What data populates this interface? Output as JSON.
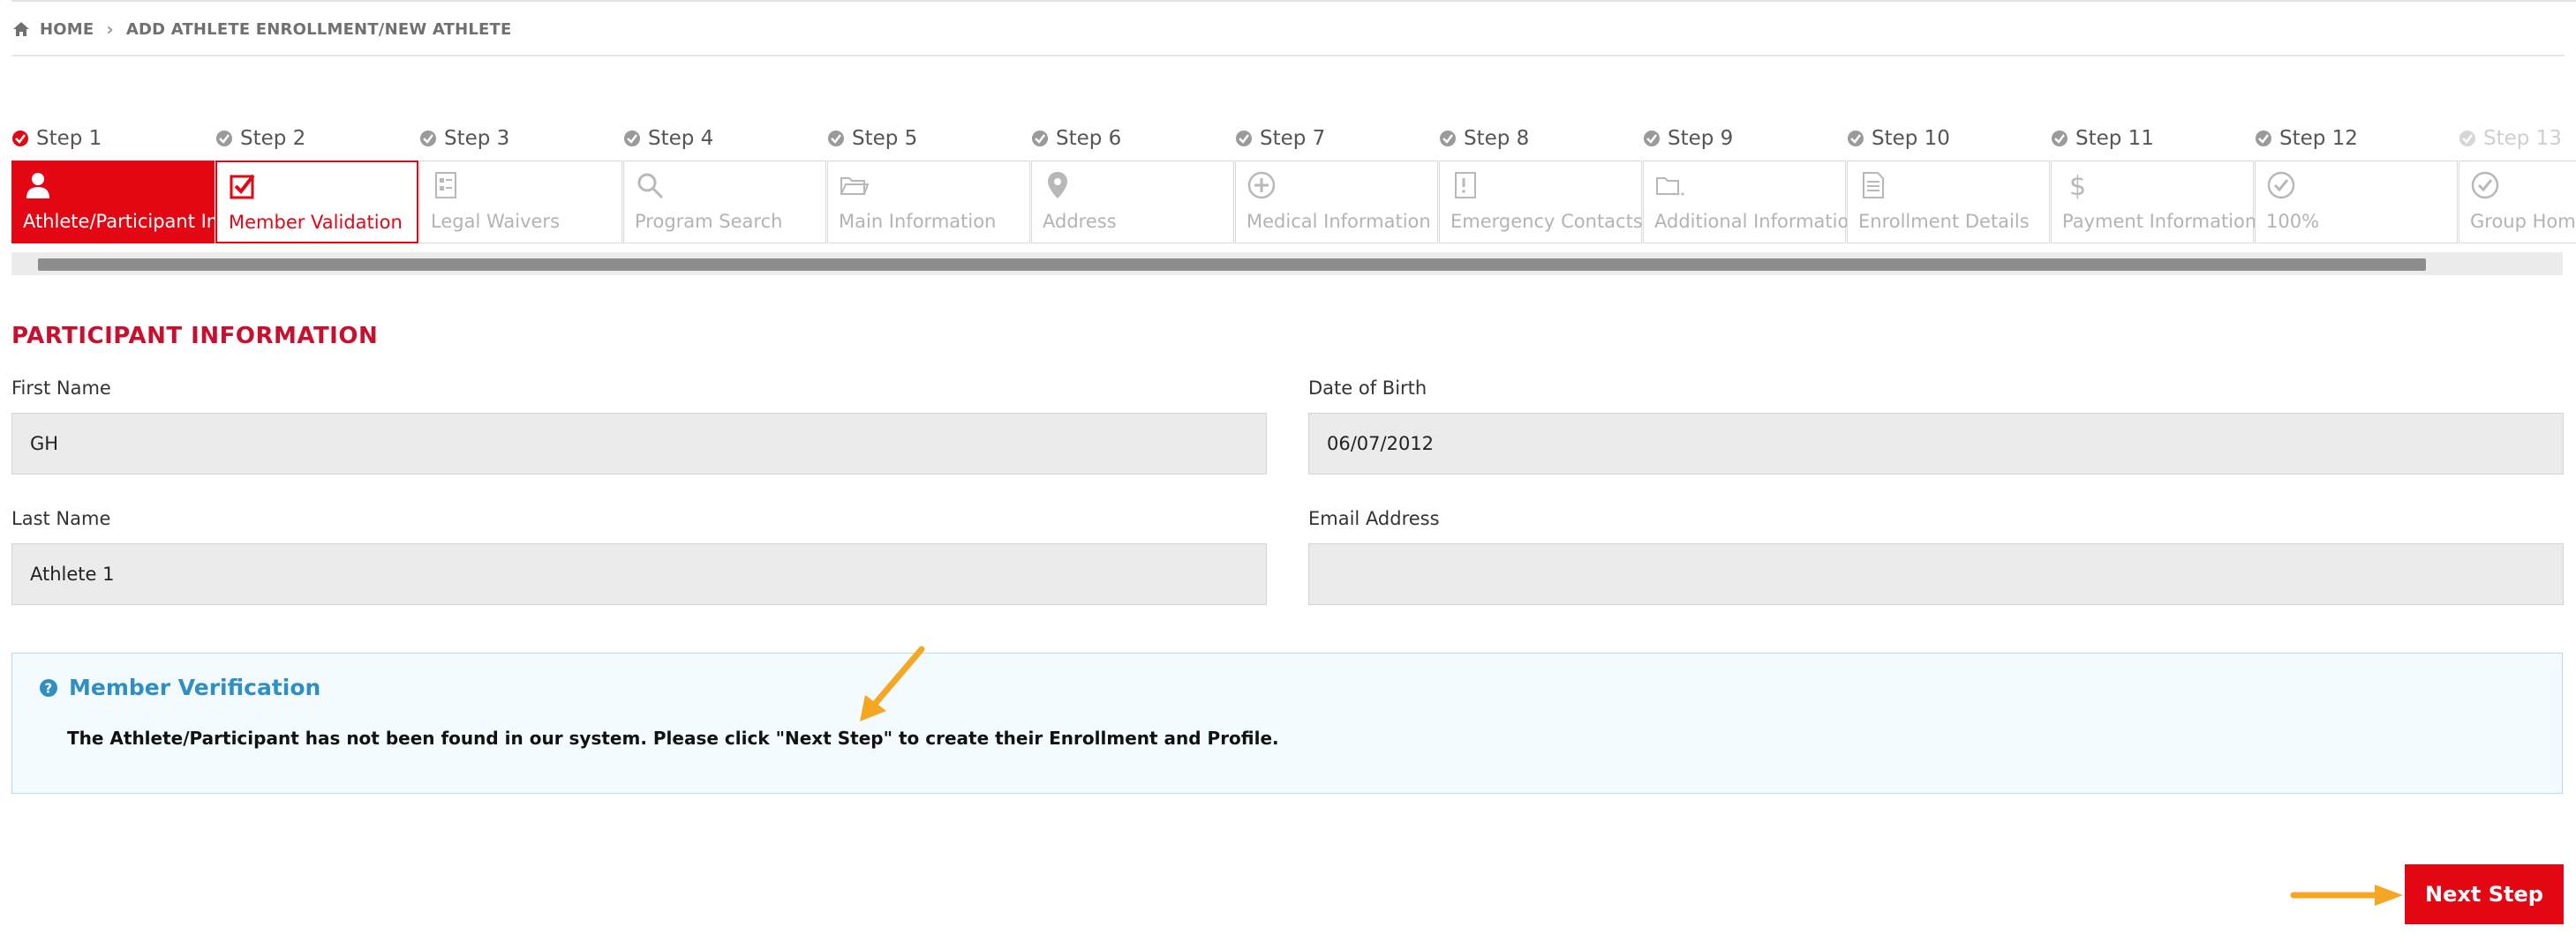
{
  "breadcrumb": {
    "home": "HOME",
    "current": "ADD ATHLETE ENROLLMENT/NEW ATHLETE"
  },
  "steps": [
    {
      "step": "Step 1",
      "label": "Athlete/Participant Info",
      "icon": "person-icon",
      "state": "active"
    },
    {
      "step": "Step 2",
      "label": "Member Validation",
      "icon": "checkbox-icon",
      "state": "current"
    },
    {
      "step": "Step 3",
      "label": "Legal Waivers",
      "icon": "form-icon",
      "state": "pending"
    },
    {
      "step": "Step 4",
      "label": "Program Search",
      "icon": "search-icon",
      "state": "pending"
    },
    {
      "step": "Step 5",
      "label": "Main Information",
      "icon": "folder-icon",
      "state": "pending"
    },
    {
      "step": "Step 6",
      "label": "Address",
      "icon": "map-pin-icon",
      "state": "pending"
    },
    {
      "step": "Step 7",
      "label": "Medical Information",
      "icon": "plus-circle-icon",
      "state": "pending"
    },
    {
      "step": "Step 8",
      "label": "Emergency Contacts",
      "icon": "alert-doc-icon",
      "state": "pending"
    },
    {
      "step": "Step 9",
      "label": "Additional Information",
      "icon": "folder-dots-icon",
      "state": "pending"
    },
    {
      "step": "Step 10",
      "label": "Enrollment Details",
      "icon": "document-icon",
      "state": "pending"
    },
    {
      "step": "Step 11",
      "label": "Payment Information",
      "icon": "dollar-icon",
      "state": "pending"
    },
    {
      "step": "Step 12",
      "label": "100%",
      "icon": "check-circle-icon",
      "state": "pending"
    },
    {
      "step": "Step 13",
      "label": "Group Home",
      "icon": "check-circle-icon",
      "state": "faded"
    }
  ],
  "section": {
    "title": "PARTICIPANT INFORMATION"
  },
  "form": {
    "first_name_label": "First Name",
    "first_name_value": "GH",
    "dob_label": "Date of Birth",
    "dob_value": "06/07/2012",
    "last_name_label": "Last Name",
    "last_name_value": "Athlete 1",
    "email_label": "Email Address",
    "email_value": ""
  },
  "verification": {
    "title": "Member Verification",
    "message": "The Athlete/Participant has not been found in our system. Please click \"Next Step\" to create their Enrollment and Profile."
  },
  "actions": {
    "next_label": "Next Step"
  },
  "colors": {
    "brand_red": "#e30613",
    "heading_red": "#c8102e",
    "info_blue": "#2f8ec4",
    "annotation_arrow": "#f5a623"
  }
}
